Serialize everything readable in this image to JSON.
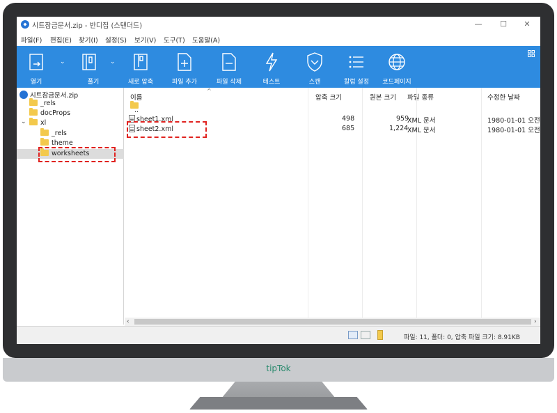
{
  "window": {
    "title": "시트잠금문서.zip - 반디집 (스탠더드)",
    "minimize": "—",
    "maximize": "☐",
    "close": "✕"
  },
  "menu": [
    "파일(F)",
    "편집(E)",
    "찾기(I)",
    "설정(S)",
    "보기(V)",
    "도구(T)",
    "도움말(A)"
  ],
  "toolbar": [
    {
      "label": "열기",
      "icon": "open-icon"
    },
    {
      "label": "풀기",
      "icon": "extract-icon"
    },
    {
      "label": "새로 압축",
      "icon": "new-archive-icon"
    },
    {
      "label": "파일 추가",
      "icon": "add-file-icon"
    },
    {
      "label": "파일 삭제",
      "icon": "delete-file-icon"
    },
    {
      "label": "테스트",
      "icon": "test-icon"
    },
    {
      "label": "스캔",
      "icon": "scan-icon"
    },
    {
      "label": "칼럼 설정",
      "icon": "columns-icon"
    },
    {
      "label": "코드페이지",
      "icon": "codepage-icon"
    }
  ],
  "tree": {
    "root": "시트잠금문서.zip",
    "items": [
      {
        "label": "_rels"
      },
      {
        "label": "docProps"
      },
      {
        "label": "xl"
      },
      {
        "label": "_rels"
      },
      {
        "label": "theme"
      },
      {
        "label": "worksheets"
      }
    ]
  },
  "list": {
    "columns": [
      "이름",
      "압축 크기",
      "원본 크기",
      "파일 종류",
      "수정한 날짜"
    ],
    "parent": "..",
    "rows": [
      {
        "name": "sheet1.xml",
        "packed": "498",
        "size": "959",
        "type": "XML 문서",
        "date": "1980-01-01 오전"
      },
      {
        "name": "sheet2.xml",
        "packed": "685",
        "size": "1,224",
        "type": "XML 문서",
        "date": "1980-01-01 오전"
      }
    ]
  },
  "status": "파일: 11, 폴더: 0, 압축 파일 크기: 8.91KB",
  "brand": "tipTok",
  "colors": {
    "toolbar": "#2e8be0",
    "highlight": "#e0221f",
    "brand": "#2b8a6e"
  }
}
